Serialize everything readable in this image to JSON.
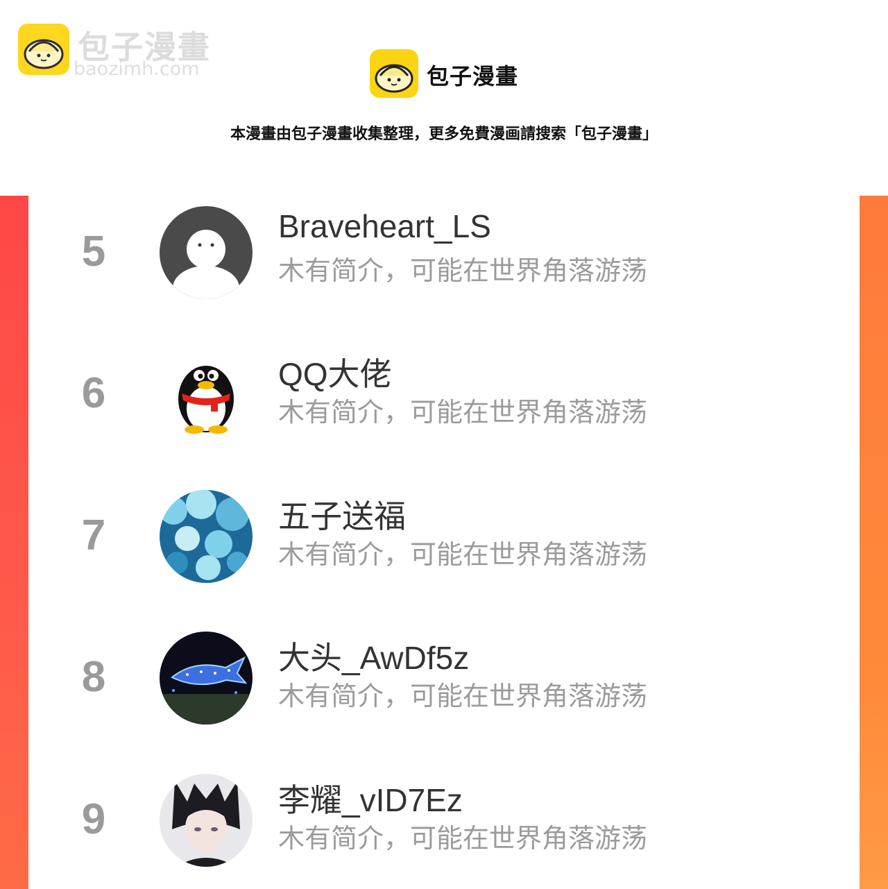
{
  "watermark": {
    "title": "包子漫畫",
    "url": "baozimh.com"
  },
  "header": {
    "logo_title": "包子漫畫",
    "notice": "本漫畫由包子漫畫收集整理，更多免費漫画請搜索「包子漫畫」"
  },
  "ranking": {
    "rows": [
      {
        "rank": "5",
        "name": "Braveheart_LS",
        "bio": "木有简介，可能在世界角落游荡",
        "avatar": "default-user-avatar"
      },
      {
        "rank": "6",
        "name": "QQ大佬",
        "bio": "木有简介，可能在世界角落游荡",
        "avatar": "penguin-avatar"
      },
      {
        "rank": "7",
        "name": "五子送福",
        "bio": "木有简介，可能在世界角落游荡",
        "avatar": "blue-clouds-avatar"
      },
      {
        "rank": "8",
        "name": "大头_AwDf5z",
        "bio": "木有简介，可能在世界角落游荡",
        "avatar": "light-shark-avatar"
      },
      {
        "rank": "9",
        "name": "李耀_vID7Ez",
        "bio": "木有简介，可能在世界角落游荡",
        "avatar": "anime-girl-avatar"
      }
    ]
  },
  "colors": {
    "accent_left": "#ff4747",
    "accent_right": "#ff8a3a",
    "logo_yellow": "#fbd514",
    "rank_gray": "#9a9a9a",
    "bio_gray": "#9b9b9b"
  }
}
